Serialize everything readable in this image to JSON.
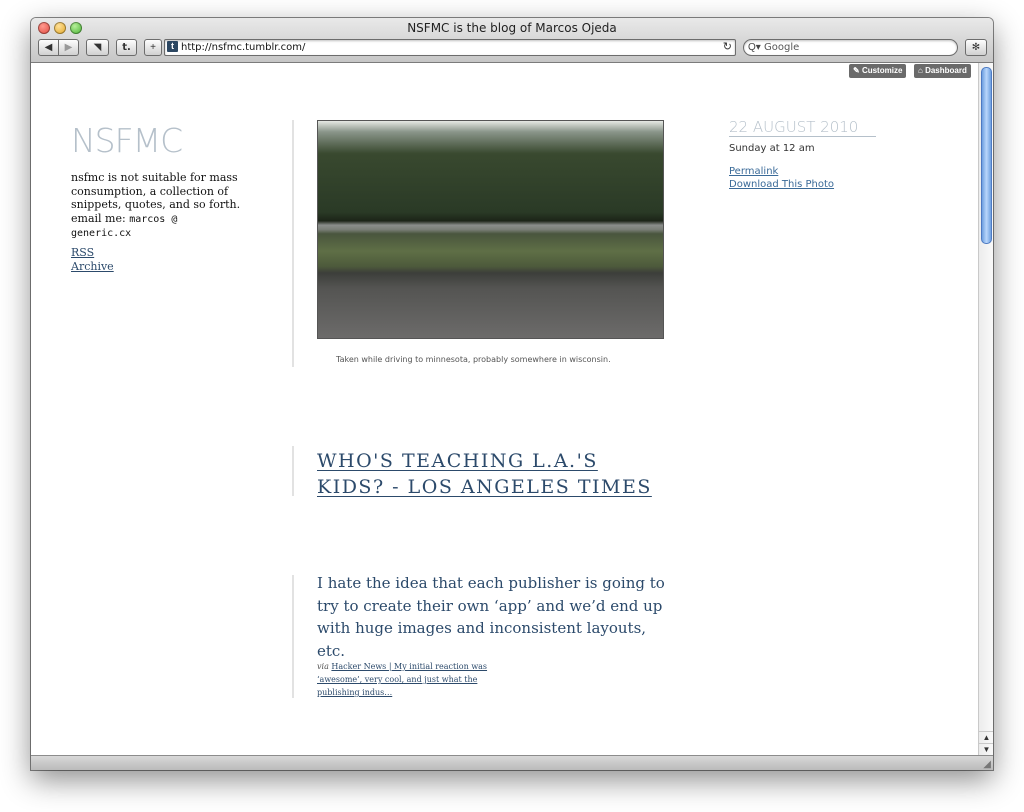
{
  "window": {
    "title": "NSFMC is the blog of Marcos Ojeda"
  },
  "toolbar": {
    "back_glyph": "◀",
    "forward_glyph": "▶",
    "bookmarks_glyph": "◥",
    "tumblr_glyph": "t.",
    "add_glyph": "+",
    "url": "http://nsfmc.tumblr.com/",
    "reload_glyph": "↻",
    "search_placeholder": "Google",
    "search_icon": "Q▾",
    "bug_glyph": "✻"
  },
  "tumblr_controls": {
    "customize": "Customize",
    "dashboard": "Dashboard"
  },
  "sidebar": {
    "title": "NSFMC",
    "description": "nsfmc is not suitable for mass consumption, a collection of snippets, quotes, and so forth. email me:",
    "email": "marcos @ generic.cx",
    "links": [
      {
        "label": "RSS"
      },
      {
        "label": "Archive"
      }
    ]
  },
  "photo_post": {
    "caption": "Taken while driving to minnesota, probably somewhere in wisconsin.",
    "date": "22 AUGUST 2010",
    "day": "Sunday at 12 am",
    "permalink": "Permalink",
    "download": "Download This Photo"
  },
  "link_post": {
    "title": "Who's teaching L.A.'s kids? - Los Angeles Times"
  },
  "quote_post": {
    "text": "I hate the idea that each publisher is going to try to create their own ‘app’ and we’d end up with huge images and inconsistent layouts, etc.",
    "via_label": "via",
    "via_link": "Hacker News | My initial reaction was ‘awesome’, very cool, and just what the publishing indus…"
  },
  "colors": {
    "link": "#2c4a6b",
    "title_light": "#b5c0ca",
    "scroll_thumb": "#6d9fe0"
  },
  "icons": {
    "customize": "wrench-icon",
    "dashboard": "house-icon",
    "search": "magnifier-icon",
    "reload": "reload-icon",
    "bug": "bug-icon"
  }
}
